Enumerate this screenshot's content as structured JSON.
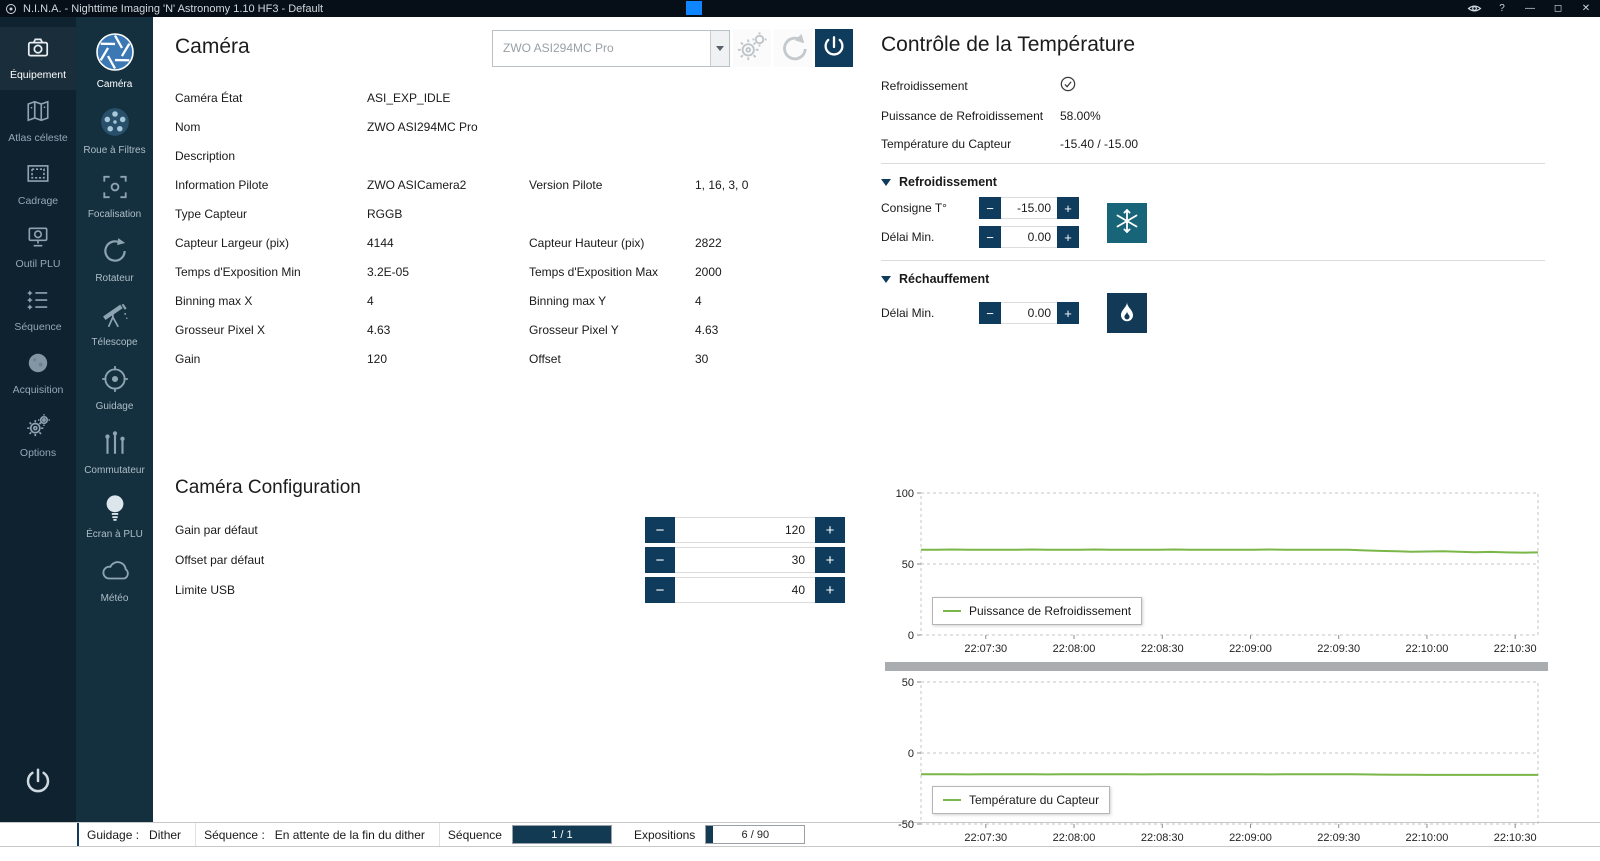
{
  "colors": {
    "accent": "#0f3c5c",
    "titlebar": "#060f17",
    "sidebar": "#0e2230",
    "subnav": "#14303e",
    "cool-button": "#186478",
    "flame-button": "#123a56",
    "chart-green": "#7ab648",
    "statusbar-fill": "#123a52"
  },
  "titlebar": {
    "title": "N.I.N.A. - Nighttime Imaging 'N' Astronomy 1.10 HF3  -  Default",
    "help": "?",
    "minimize": "—",
    "maximize": "◻",
    "close": "✕"
  },
  "sidebar": {
    "items": [
      {
        "label": "Équipement",
        "active": true
      },
      {
        "label": "Atlas céleste",
        "active": false
      },
      {
        "label": "Cadrage",
        "active": false
      },
      {
        "label": "Outil PLU",
        "active": false
      },
      {
        "label": "Séquence",
        "active": false
      },
      {
        "label": "Acquisition",
        "active": false
      },
      {
        "label": "Options",
        "active": false
      }
    ]
  },
  "equipment_nav": {
    "items": [
      {
        "label": "Caméra",
        "active": true
      },
      {
        "label": "Roue à Filtres",
        "active": false
      },
      {
        "label": "Focalisation",
        "active": false
      },
      {
        "label": "Rotateur",
        "active": false
      },
      {
        "label": "Télescope",
        "active": false
      },
      {
        "label": "Guidage",
        "active": false
      },
      {
        "label": "Commutateur",
        "active": false
      },
      {
        "label": "Écran à PLU",
        "active": false
      },
      {
        "label": "Météo",
        "active": false
      }
    ]
  },
  "camera": {
    "title": "Caméra",
    "device_select": {
      "value": "ZWO ASI294MC Pro"
    },
    "info_rows": [
      {
        "l1": "Caméra État",
        "v1": "ASI_EXP_IDLE",
        "l2": "",
        "v2": ""
      },
      {
        "l1": "Nom",
        "v1": "ZWO ASI294MC Pro",
        "l2": "",
        "v2": ""
      },
      {
        "l1": "Description",
        "v1": "",
        "l2": "",
        "v2": ""
      },
      {
        "l1": "Information Pilote",
        "v1": "ZWO ASICamera2",
        "l2": "Version Pilote",
        "v2": "1, 16, 3, 0"
      },
      {
        "l1": "Type Capteur",
        "v1": "RGGB",
        "l2": "",
        "v2": ""
      },
      {
        "l1": "Capteur Largeur (pix)",
        "v1": "4144",
        "l2": "Capteur Hauteur (pix)",
        "v2": "2822"
      },
      {
        "l1": "Temps d'Exposition Min",
        "v1": "3.2E-05",
        "l2": "Temps d'Exposition Max",
        "v2": "2000"
      },
      {
        "l1": "Binning max X",
        "v1": "4",
        "l2": "Binning max Y",
        "v2": "4"
      },
      {
        "l1": "Grosseur Pixel X",
        "v1": "4.63",
        "l2": "Grosseur Pixel Y",
        "v2": "4.63"
      },
      {
        "l1": "Gain",
        "v1": "120",
        "l2": "Offset",
        "v2": "30"
      }
    ],
    "config": {
      "title": "Caméra Configuration",
      "rows": [
        {
          "label": "Gain par défaut",
          "value": "120"
        },
        {
          "label": "Offset par défaut",
          "value": "30"
        },
        {
          "label": "Limite USB",
          "value": "40"
        }
      ]
    }
  },
  "temperature": {
    "title": "Contrôle de la Température",
    "status_rows": [
      {
        "label": "Refroidissement",
        "value": ""
      },
      {
        "label": "Puissance de Refroidissement",
        "value": "58.00%"
      },
      {
        "label": "Température du Capteur",
        "value": "-15.40 /  -15.00"
      }
    ],
    "cooling": {
      "title": "Refroidissement",
      "rows": [
        {
          "label": "Consigne T°",
          "value": "-15.00"
        },
        {
          "label": "Délai Min.",
          "value": "0.00"
        }
      ]
    },
    "warming": {
      "title": "Réchauffement",
      "rows": [
        {
          "label": "Délai Min.",
          "value": "0.00"
        }
      ]
    }
  },
  "chart_data": [
    {
      "type": "line",
      "title": "",
      "xlabel": "",
      "ylabel": "",
      "ylim": [
        0,
        100
      ],
      "yticks": [
        0,
        50,
        100
      ],
      "grid": "dashed",
      "legend_position": "bottom-left",
      "x_tick_fracs_range": [
        0.105,
        0.963
      ],
      "x_labels": [
        "22:07:30",
        "22:08:00",
        "22:08:30",
        "22:09:00",
        "22:09:30",
        "22:10:00",
        "22:10:30"
      ],
      "series": [
        {
          "name": "Puissance de Refroidissement",
          "color": "#7ab648",
          "values": [
            60,
            60,
            60.2,
            60,
            60,
            60,
            60,
            60.2,
            60,
            60,
            60,
            60.2,
            60,
            60,
            60,
            60,
            60.2,
            60,
            60,
            60,
            60,
            60,
            60.2,
            60,
            60,
            60,
            60,
            60,
            59.6,
            59.2,
            59,
            58.6,
            58.8,
            59,
            58.6,
            58.3,
            58.5,
            58.2,
            58,
            58.2
          ]
        }
      ]
    },
    {
      "type": "line",
      "title": "",
      "xlabel": "",
      "ylabel": "",
      "ylim": [
        -50,
        50
      ],
      "yticks": [
        -50,
        0,
        50
      ],
      "grid": "dashed",
      "legend_position": "bottom-left",
      "x_tick_fracs_range": [
        0.105,
        0.963
      ],
      "x_labels": [
        "22:07:30",
        "22:08:00",
        "22:08:30",
        "22:09:00",
        "22:09:30",
        "22:10:00",
        "22:10:30"
      ],
      "series": [
        {
          "name": "Température du Capteur",
          "color": "#7ab648",
          "values": [
            -15,
            -15,
            -15,
            -15.05,
            -15,
            -15,
            -15,
            -15,
            -15.05,
            -15,
            -15,
            -15,
            -15,
            -15,
            -15.05,
            -15,
            -15,
            -15,
            -15,
            -15,
            -15,
            -15,
            -15.05,
            -15,
            -15,
            -15,
            -15,
            -15,
            -15.1,
            -15.2,
            -15.3,
            -15.35,
            -15.4,
            -15.4,
            -15.4,
            -15.4,
            -15.4,
            -15.4,
            -15.4,
            -15.4
          ]
        }
      ]
    }
  ],
  "statusbar": {
    "guidage_label": "Guidage :",
    "guidage_value": "Dither",
    "sequence_label": "Séquence :",
    "sequence_value": "En attente de la fin du dither",
    "sequence_progress": {
      "label": "Séquence",
      "text": "1 / 1",
      "percent": "100%"
    },
    "expositions_progress": {
      "label": "Expositions",
      "text": "6 / 90",
      "percent": "7%"
    }
  }
}
